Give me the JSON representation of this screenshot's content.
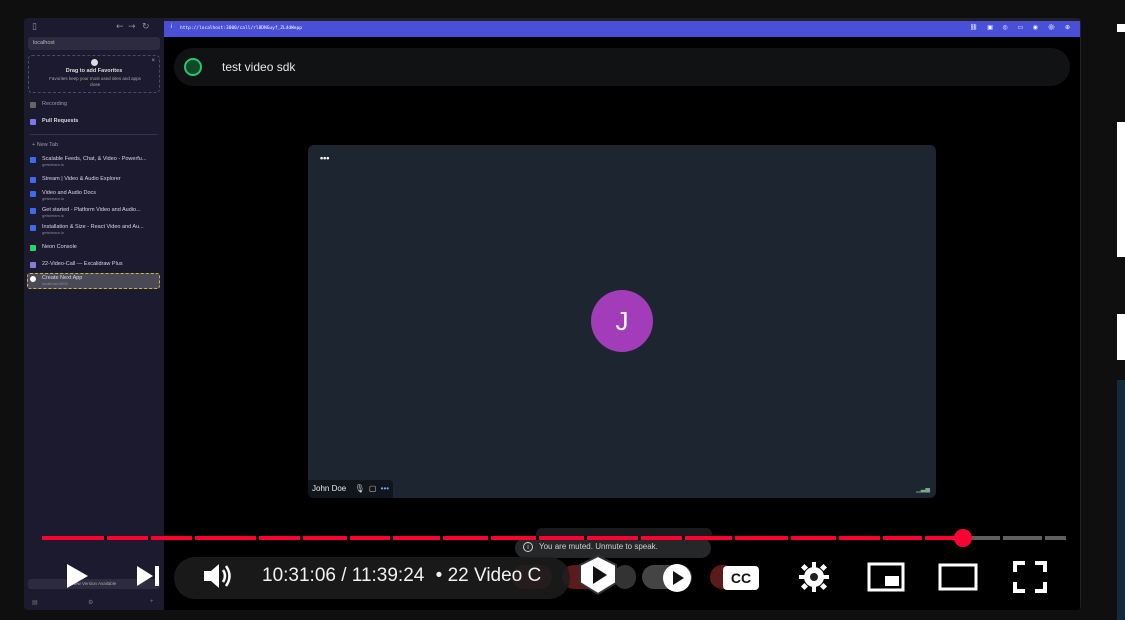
{
  "sidebar": {
    "url": "localhost",
    "favorites_title": "Drag to add Favorites",
    "favorites_desc": "Favorites keep your most used sites and apps close",
    "items": [
      {
        "label": "Recording",
        "sub": "",
        "color": "#666"
      },
      {
        "label": "Pull Requests",
        "sub": "",
        "color": "#7a7af0"
      },
      {
        "label": "+ New Tab",
        "sub": "",
        "color": ""
      },
      {
        "label": "Scalable Feeds, Chat, & Video - Powerfu...",
        "sub": "getstream.io",
        "color": "#3b6cf0"
      },
      {
        "label": "Stream | Video & Audio Explorer",
        "sub": "",
        "color": "#3b6cf0"
      },
      {
        "label": "Video and Audio Docs",
        "sub": "getstream.io",
        "color": "#3b6cf0"
      },
      {
        "label": "Get started - Platform Video and Audio...",
        "sub": "getstream.io",
        "color": "#3b6cf0"
      },
      {
        "label": "Installation & Size - React Video and Au...",
        "sub": "getstream.io",
        "color": "#3b6cf0"
      },
      {
        "label": "Neon Console",
        "sub": "",
        "color": "#2bd46a"
      },
      {
        "label": "22-Video-Call — Excalidraw Plus",
        "sub": "",
        "color": "#8a7ae0"
      },
      {
        "label": "Create Next App",
        "sub": "localhost:3000",
        "color": "#ffffff"
      }
    ],
    "bottom_label": "New Version Available"
  },
  "browser": {
    "url": "http://localhost:3000/call/rl8DNGuyf_ZL4dWepp"
  },
  "call": {
    "name": "test video sdk",
    "participant_initial": "J",
    "participant_name": "John Doe",
    "toast": "You are muted. Unmute to speak."
  },
  "player": {
    "time": "10:31:06 / 11:39:24",
    "title": "• 22 Video C",
    "progress_fraction": 0.899,
    "cc_label": "CC",
    "accent": "#ff0033"
  }
}
